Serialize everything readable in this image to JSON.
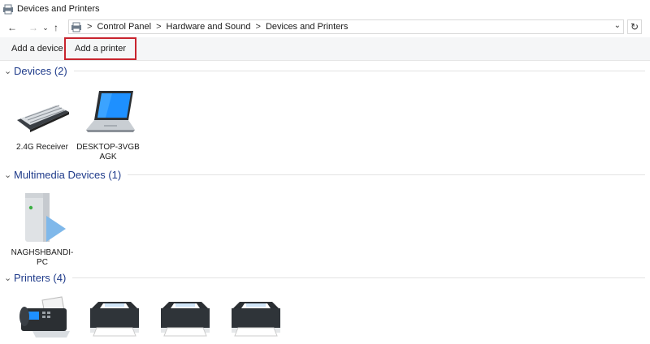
{
  "window": {
    "title": "Devices and Printers"
  },
  "nav": {
    "back_icon": "arrow-left-icon",
    "forward_icon": "arrow-right-icon",
    "recent_icon": "chevron-down-icon",
    "up_icon": "arrow-up-icon"
  },
  "address": {
    "breadcrumbs": [
      "Control Panel",
      "Hardware and Sound",
      "Devices and Printers"
    ],
    "separator": ">",
    "dropdown_glyph": "⌄",
    "refresh_glyph": "↻"
  },
  "toolbar": {
    "add_device": "Add a device",
    "add_printer": "Add a printer",
    "highlight_color": "#c8242e"
  },
  "groups": {
    "devices": {
      "label": "Devices (2)",
      "items": [
        {
          "label": "2.4G Receiver",
          "icon": "keyboard-icon"
        },
        {
          "label": "DESKTOP-3VGBAGK",
          "icon": "laptop-icon"
        }
      ]
    },
    "multimedia": {
      "label": "Multimedia Devices (1)",
      "items": [
        {
          "label": "NAGHSHBANDI-PC",
          "icon": "media-server-icon"
        }
      ]
    },
    "printers": {
      "label": "Printers (4)",
      "items": [
        {
          "label": "",
          "icon": "fax-icon"
        },
        {
          "label": "",
          "icon": "printer-icon"
        },
        {
          "label": "",
          "icon": "printer-icon"
        },
        {
          "label": "",
          "icon": "printer-icon"
        }
      ]
    }
  }
}
